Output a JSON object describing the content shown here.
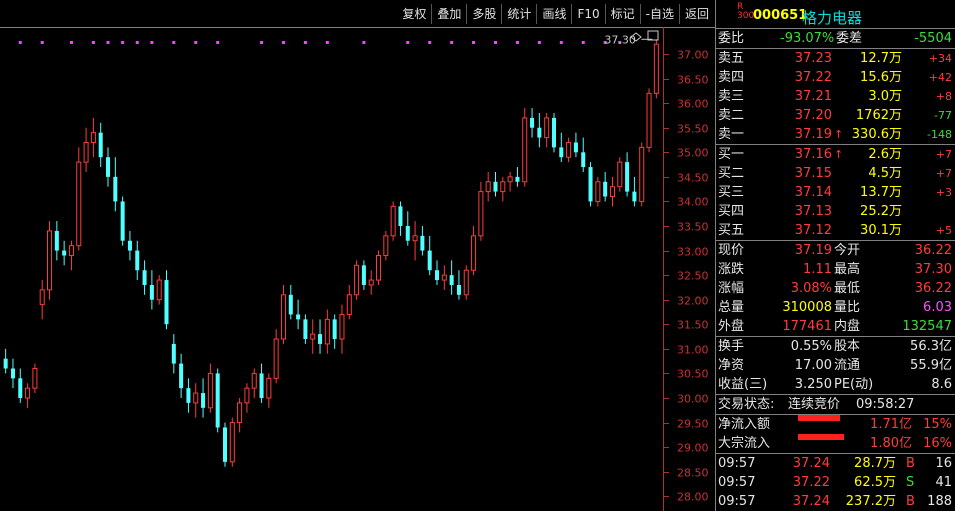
{
  "toolbar": [
    "复权",
    "叠加",
    "多股",
    "统计",
    "画线",
    "F10",
    "标记",
    "-自选",
    "返回"
  ],
  "chart": {
    "peak_label": "37.30",
    "ylim": [
      27.7,
      37.55
    ],
    "y_ticks": [
      "37.00",
      "36.50",
      "36.00",
      "35.50",
      "35.00",
      "34.50",
      "34.00",
      "33.50",
      "33.00",
      "32.50",
      "32.00",
      "31.50",
      "31.00",
      "30.50",
      "30.00",
      "29.50",
      "29.00",
      "28.50",
      "28.00"
    ]
  },
  "chart_data": {
    "type": "candlestick",
    "candles": [
      {
        "o": 30.8,
        "h": 31.0,
        "l": 30.5,
        "c": 30.6
      },
      {
        "o": 30.6,
        "h": 30.8,
        "l": 30.2,
        "c": 30.4
      },
      {
        "o": 30.4,
        "h": 30.6,
        "l": 29.9,
        "c": 30.0
      },
      {
        "o": 30.0,
        "h": 30.3,
        "l": 29.8,
        "c": 30.2
      },
      {
        "o": 30.2,
        "h": 30.7,
        "l": 30.1,
        "c": 30.6
      },
      {
        "o": 31.9,
        "h": 32.4,
        "l": 31.6,
        "c": 32.2
      },
      {
        "o": 32.2,
        "h": 33.6,
        "l": 32.0,
        "c": 33.4
      },
      {
        "o": 33.4,
        "h": 33.6,
        "l": 32.8,
        "c": 33.0
      },
      {
        "o": 33.0,
        "h": 33.2,
        "l": 32.7,
        "c": 32.9
      },
      {
        "o": 32.9,
        "h": 33.2,
        "l": 32.6,
        "c": 33.1
      },
      {
        "o": 33.1,
        "h": 35.1,
        "l": 33.0,
        "c": 34.8
      },
      {
        "o": 34.8,
        "h": 35.5,
        "l": 34.6,
        "c": 35.2
      },
      {
        "o": 35.2,
        "h": 35.7,
        "l": 34.9,
        "c": 35.4
      },
      {
        "o": 35.4,
        "h": 35.6,
        "l": 34.7,
        "c": 34.9
      },
      {
        "o": 34.9,
        "h": 35.1,
        "l": 34.3,
        "c": 34.5
      },
      {
        "o": 34.5,
        "h": 34.9,
        "l": 33.8,
        "c": 34.0
      },
      {
        "o": 34.0,
        "h": 34.1,
        "l": 33.1,
        "c": 33.2
      },
      {
        "o": 33.2,
        "h": 33.4,
        "l": 32.8,
        "c": 33.0
      },
      {
        "o": 33.0,
        "h": 33.2,
        "l": 32.4,
        "c": 32.6
      },
      {
        "o": 32.6,
        "h": 32.8,
        "l": 32.1,
        "c": 32.3
      },
      {
        "o": 32.3,
        "h": 32.6,
        "l": 31.8,
        "c": 32.0
      },
      {
        "o": 32.0,
        "h": 32.5,
        "l": 31.9,
        "c": 32.4
      },
      {
        "o": 32.4,
        "h": 32.6,
        "l": 31.4,
        "c": 31.5
      },
      {
        "o": 31.1,
        "h": 31.3,
        "l": 30.5,
        "c": 30.7
      },
      {
        "o": 30.7,
        "h": 30.9,
        "l": 30.0,
        "c": 30.2
      },
      {
        "o": 30.2,
        "h": 30.4,
        "l": 29.7,
        "c": 29.9
      },
      {
        "o": 29.9,
        "h": 30.3,
        "l": 29.6,
        "c": 30.1
      },
      {
        "o": 30.1,
        "h": 30.4,
        "l": 29.6,
        "c": 29.8
      },
      {
        "o": 29.8,
        "h": 30.7,
        "l": 29.7,
        "c": 30.5
      },
      {
        "o": 30.5,
        "h": 30.6,
        "l": 29.3,
        "c": 29.4
      },
      {
        "o": 29.4,
        "h": 29.5,
        "l": 28.6,
        "c": 28.7
      },
      {
        "o": 28.7,
        "h": 29.6,
        "l": 28.6,
        "c": 29.5
      },
      {
        "o": 29.5,
        "h": 30.0,
        "l": 29.3,
        "c": 29.9
      },
      {
        "o": 29.9,
        "h": 30.3,
        "l": 29.7,
        "c": 30.2
      },
      {
        "o": 30.2,
        "h": 30.6,
        "l": 30.0,
        "c": 30.5
      },
      {
        "o": 30.5,
        "h": 30.7,
        "l": 29.9,
        "c": 30.0
      },
      {
        "o": 30.0,
        "h": 30.5,
        "l": 29.8,
        "c": 30.4
      },
      {
        "o": 30.4,
        "h": 31.4,
        "l": 30.3,
        "c": 31.2
      },
      {
        "o": 31.2,
        "h": 32.3,
        "l": 31.1,
        "c": 32.1
      },
      {
        "o": 32.1,
        "h": 32.3,
        "l": 31.6,
        "c": 31.7
      },
      {
        "o": 31.7,
        "h": 32.0,
        "l": 31.4,
        "c": 31.6
      },
      {
        "o": 31.6,
        "h": 31.7,
        "l": 31.1,
        "c": 31.2
      },
      {
        "o": 31.2,
        "h": 31.6,
        "l": 30.9,
        "c": 31.3
      },
      {
        "o": 31.3,
        "h": 31.6,
        "l": 30.9,
        "c": 31.1
      },
      {
        "o": 31.1,
        "h": 31.8,
        "l": 30.9,
        "c": 31.6
      },
      {
        "o": 31.6,
        "h": 31.7,
        "l": 31.0,
        "c": 31.2
      },
      {
        "o": 31.2,
        "h": 31.9,
        "l": 30.9,
        "c": 31.7
      },
      {
        "o": 31.7,
        "h": 32.3,
        "l": 31.6,
        "c": 32.1
      },
      {
        "o": 32.1,
        "h": 32.8,
        "l": 32.0,
        "c": 32.7
      },
      {
        "o": 32.7,
        "h": 32.8,
        "l": 32.2,
        "c": 32.3
      },
      {
        "o": 32.3,
        "h": 32.6,
        "l": 32.1,
        "c": 32.4
      },
      {
        "o": 32.4,
        "h": 33.0,
        "l": 32.3,
        "c": 32.9
      },
      {
        "o": 32.9,
        "h": 33.4,
        "l": 32.8,
        "c": 33.3
      },
      {
        "o": 33.3,
        "h": 34.0,
        "l": 33.2,
        "c": 33.9
      },
      {
        "o": 33.9,
        "h": 34.0,
        "l": 33.3,
        "c": 33.5
      },
      {
        "o": 33.5,
        "h": 33.8,
        "l": 33.1,
        "c": 33.2
      },
      {
        "o": 33.2,
        "h": 33.6,
        "l": 32.8,
        "c": 33.3
      },
      {
        "o": 33.3,
        "h": 33.5,
        "l": 32.9,
        "c": 33.0
      },
      {
        "o": 33.0,
        "h": 33.3,
        "l": 32.5,
        "c": 32.6
      },
      {
        "o": 32.6,
        "h": 32.8,
        "l": 32.3,
        "c": 32.4
      },
      {
        "o": 32.4,
        "h": 32.7,
        "l": 32.2,
        "c": 32.5
      },
      {
        "o": 32.5,
        "h": 32.8,
        "l": 32.1,
        "c": 32.3
      },
      {
        "o": 32.3,
        "h": 32.6,
        "l": 32.0,
        "c": 32.1
      },
      {
        "o": 32.1,
        "h": 32.7,
        "l": 32.0,
        "c": 32.6
      },
      {
        "o": 32.6,
        "h": 33.5,
        "l": 32.5,
        "c": 33.3
      },
      {
        "o": 33.3,
        "h": 34.4,
        "l": 33.2,
        "c": 34.2
      },
      {
        "o": 34.2,
        "h": 34.6,
        "l": 34.0,
        "c": 34.4
      },
      {
        "o": 34.4,
        "h": 34.6,
        "l": 34.1,
        "c": 34.2
      },
      {
        "o": 34.2,
        "h": 34.5,
        "l": 34.0,
        "c": 34.4
      },
      {
        "o": 34.4,
        "h": 34.6,
        "l": 34.2,
        "c": 34.5
      },
      {
        "o": 34.5,
        "h": 34.7,
        "l": 34.3,
        "c": 34.4
      },
      {
        "o": 34.4,
        "h": 35.9,
        "l": 34.3,
        "c": 35.7
      },
      {
        "o": 35.7,
        "h": 35.9,
        "l": 35.3,
        "c": 35.5
      },
      {
        "o": 35.5,
        "h": 35.8,
        "l": 35.1,
        "c": 35.3
      },
      {
        "o": 35.3,
        "h": 35.8,
        "l": 35.1,
        "c": 35.7
      },
      {
        "o": 35.7,
        "h": 35.8,
        "l": 35.0,
        "c": 35.1
      },
      {
        "o": 35.1,
        "h": 35.4,
        "l": 34.8,
        "c": 34.9
      },
      {
        "o": 34.9,
        "h": 35.3,
        "l": 34.8,
        "c": 35.2
      },
      {
        "o": 35.2,
        "h": 35.4,
        "l": 34.9,
        "c": 35.0
      },
      {
        "o": 35.0,
        "h": 35.3,
        "l": 34.6,
        "c": 34.7
      },
      {
        "o": 34.7,
        "h": 34.8,
        "l": 33.9,
        "c": 34.0
      },
      {
        "o": 34.0,
        "h": 34.5,
        "l": 33.9,
        "c": 34.4
      },
      {
        "o": 34.4,
        "h": 34.6,
        "l": 34.0,
        "c": 34.1
      },
      {
        "o": 34.1,
        "h": 34.5,
        "l": 33.9,
        "c": 34.3
      },
      {
        "o": 34.3,
        "h": 34.9,
        "l": 34.2,
        "c": 34.8
      },
      {
        "o": 34.8,
        "h": 35.0,
        "l": 34.1,
        "c": 34.2
      },
      {
        "o": 34.2,
        "h": 34.5,
        "l": 33.9,
        "c": 34.0
      },
      {
        "o": 34.0,
        "h": 35.2,
        "l": 33.9,
        "c": 35.1
      },
      {
        "o": 35.1,
        "h": 36.3,
        "l": 35.0,
        "c": 36.2
      },
      {
        "o": 36.2,
        "h": 37.3,
        "l": 36.1,
        "c": 37.2
      }
    ],
    "dots": [
      2,
      5,
      9,
      12,
      14,
      16,
      18,
      20,
      23,
      26,
      29,
      35,
      38,
      41,
      44,
      49,
      55,
      58,
      61,
      64,
      67,
      70,
      73,
      76,
      79,
      82,
      84
    ]
  },
  "panel": {
    "r_label": "R",
    "r_label2": "300",
    "code": "000651",
    "name": "格力电器",
    "weibi": {
      "label": "委比",
      "value": "-93.07%",
      "label2": "委差",
      "value2": "-5504"
    },
    "asks": [
      {
        "label": "卖五",
        "price": "37.23",
        "vol": "12.7万",
        "chg": "+34"
      },
      {
        "label": "卖四",
        "price": "37.22",
        "vol": "15.6万",
        "chg": "+42"
      },
      {
        "label": "卖三",
        "price": "37.21",
        "vol": "3.0万",
        "chg": "+8"
      },
      {
        "label": "卖二",
        "price": "37.20",
        "vol": "1762万",
        "chg": "-77"
      },
      {
        "label": "卖一",
        "price": "37.19",
        "vol": "330.6万",
        "chg": "-148"
      }
    ],
    "bids": [
      {
        "label": "买一",
        "price": "37.16",
        "vol": "2.6万",
        "chg": "+7"
      },
      {
        "label": "买二",
        "price": "37.15",
        "vol": "4.5万",
        "chg": "+7"
      },
      {
        "label": "买三",
        "price": "37.14",
        "vol": "13.7万",
        "chg": "+3"
      },
      {
        "label": "买四",
        "price": "37.13",
        "vol": "25.2万",
        "chg": ""
      },
      {
        "label": "买五",
        "price": "37.12",
        "vol": "30.1万",
        "chg": "+5"
      }
    ],
    "quote": [
      {
        "l1": "现价",
        "v1": "37.19",
        "l2": "今开",
        "v2": "36.22"
      },
      {
        "l1": "涨跌",
        "v1": "1.11",
        "l2": "最高",
        "v2": "37.30"
      },
      {
        "l1": "涨幅",
        "v1": "3.08%",
        "l2": "最低",
        "v2": "36.22"
      },
      {
        "l1": "总量",
        "v1": "310008",
        "l2": "量比",
        "v2": "6.03"
      },
      {
        "l1": "外盘",
        "v1": "177461",
        "l2": "内盘",
        "v2": "132547"
      }
    ],
    "fund": [
      {
        "l1": "换手",
        "v1": "0.55%",
        "l2": "股本",
        "v2": "56.3亿"
      },
      {
        "l1": "净资",
        "v1": "17.00",
        "l2": "流通",
        "v2": "55.9亿"
      },
      {
        "l1": "收益(三)",
        "v1": "3.250",
        "l2": "PE(动)",
        "v2": "8.6"
      }
    ],
    "status": {
      "label": "交易状态:",
      "value": "连续竞价",
      "time": "09:58:27"
    },
    "flows": [
      {
        "label": "净流入额",
        "value": "1.71亿",
        "pct": "15%"
      },
      {
        "label": "大宗流入",
        "value": "1.80亿",
        "pct": "16%"
      }
    ],
    "ticks": [
      {
        "time": "09:57",
        "price": "37.24",
        "vol": "28.7万",
        "side": "B",
        "n": "16"
      },
      {
        "time": "09:57",
        "price": "37.22",
        "vol": "62.5万",
        "side": "S",
        "n": "41"
      },
      {
        "time": "09:57",
        "price": "37.24",
        "vol": "237.2万",
        "side": "B",
        "n": "188"
      }
    ]
  }
}
